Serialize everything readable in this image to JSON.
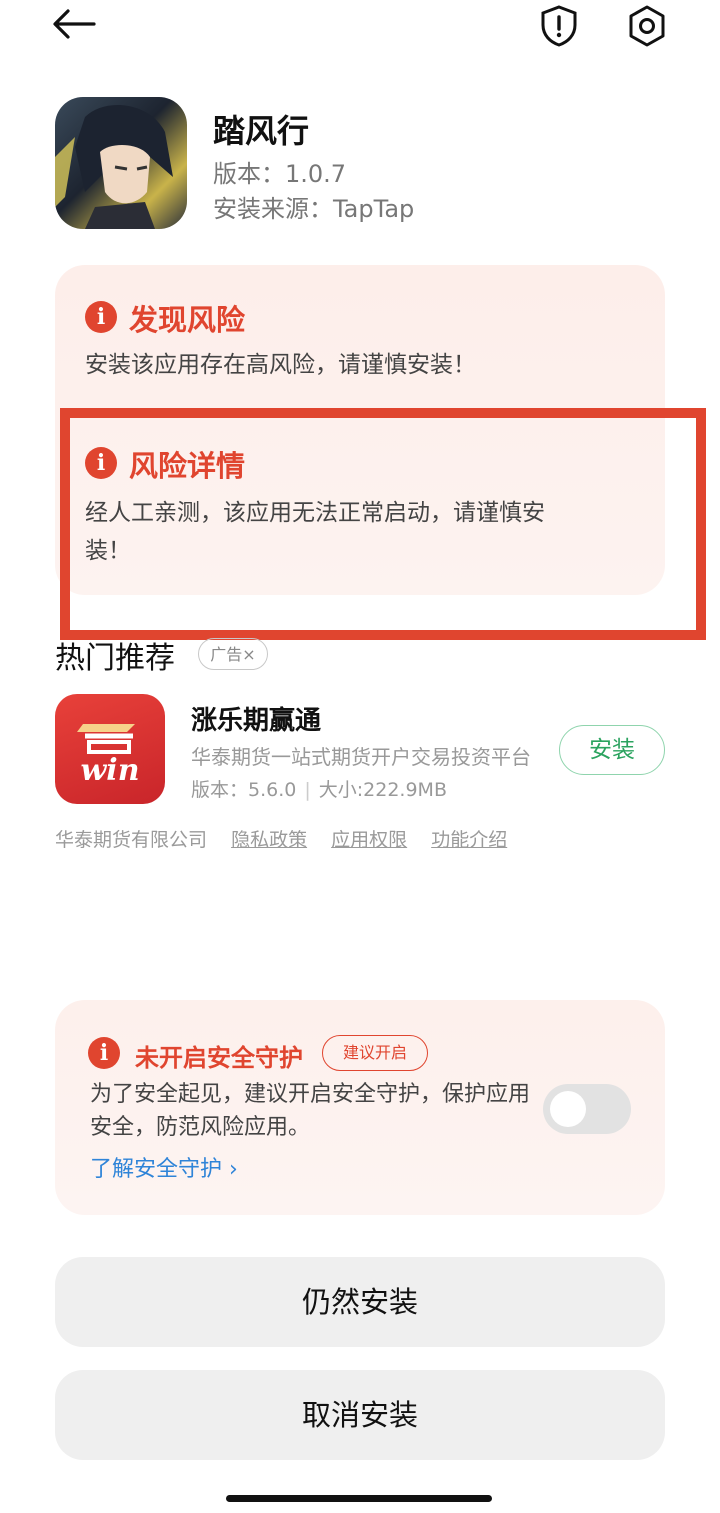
{
  "topbar": {
    "back_icon": "arrow-left-icon",
    "shield_icon": "shield-alert-icon",
    "settings_icon": "gear-icon"
  },
  "app": {
    "name": "踏风行",
    "version": "版本：1.0.7",
    "source": "安装来源：TapTap"
  },
  "risk": {
    "found_title": "发现风险",
    "found_text": "安装该应用存在高风险，请谨慎安装！",
    "detail_title": "风险详情",
    "detail_text_line1": "经人工亲测，该应用无法正常启动，请谨慎安",
    "detail_text_line2": "装！"
  },
  "recommend": {
    "title": "热门推荐",
    "ad_label": "广告×",
    "app_name": "涨乐期赢通",
    "app_desc": "华泰期货一站式期货开户交易投资平台",
    "version": "版本：5.6.0",
    "size": "大小:222.9MB",
    "install_label": "安装",
    "icon_text": "win",
    "company": "华泰期货有限公司",
    "links": [
      "隐私政策",
      "应用权限",
      "功能介绍"
    ]
  },
  "protection": {
    "title": "未开启安全守护",
    "badge": "建议开启",
    "text": "为了安全起见，建议开启安全守护，保护应用安全，防范风险应用。",
    "link": "了解安全守护",
    "enabled": false
  },
  "buttons": {
    "still_install": "仍然安装",
    "cancel_install": "取消安装"
  },
  "colors": {
    "danger": "#e0452f",
    "success": "#2ba35f",
    "link": "#2f84d8"
  }
}
